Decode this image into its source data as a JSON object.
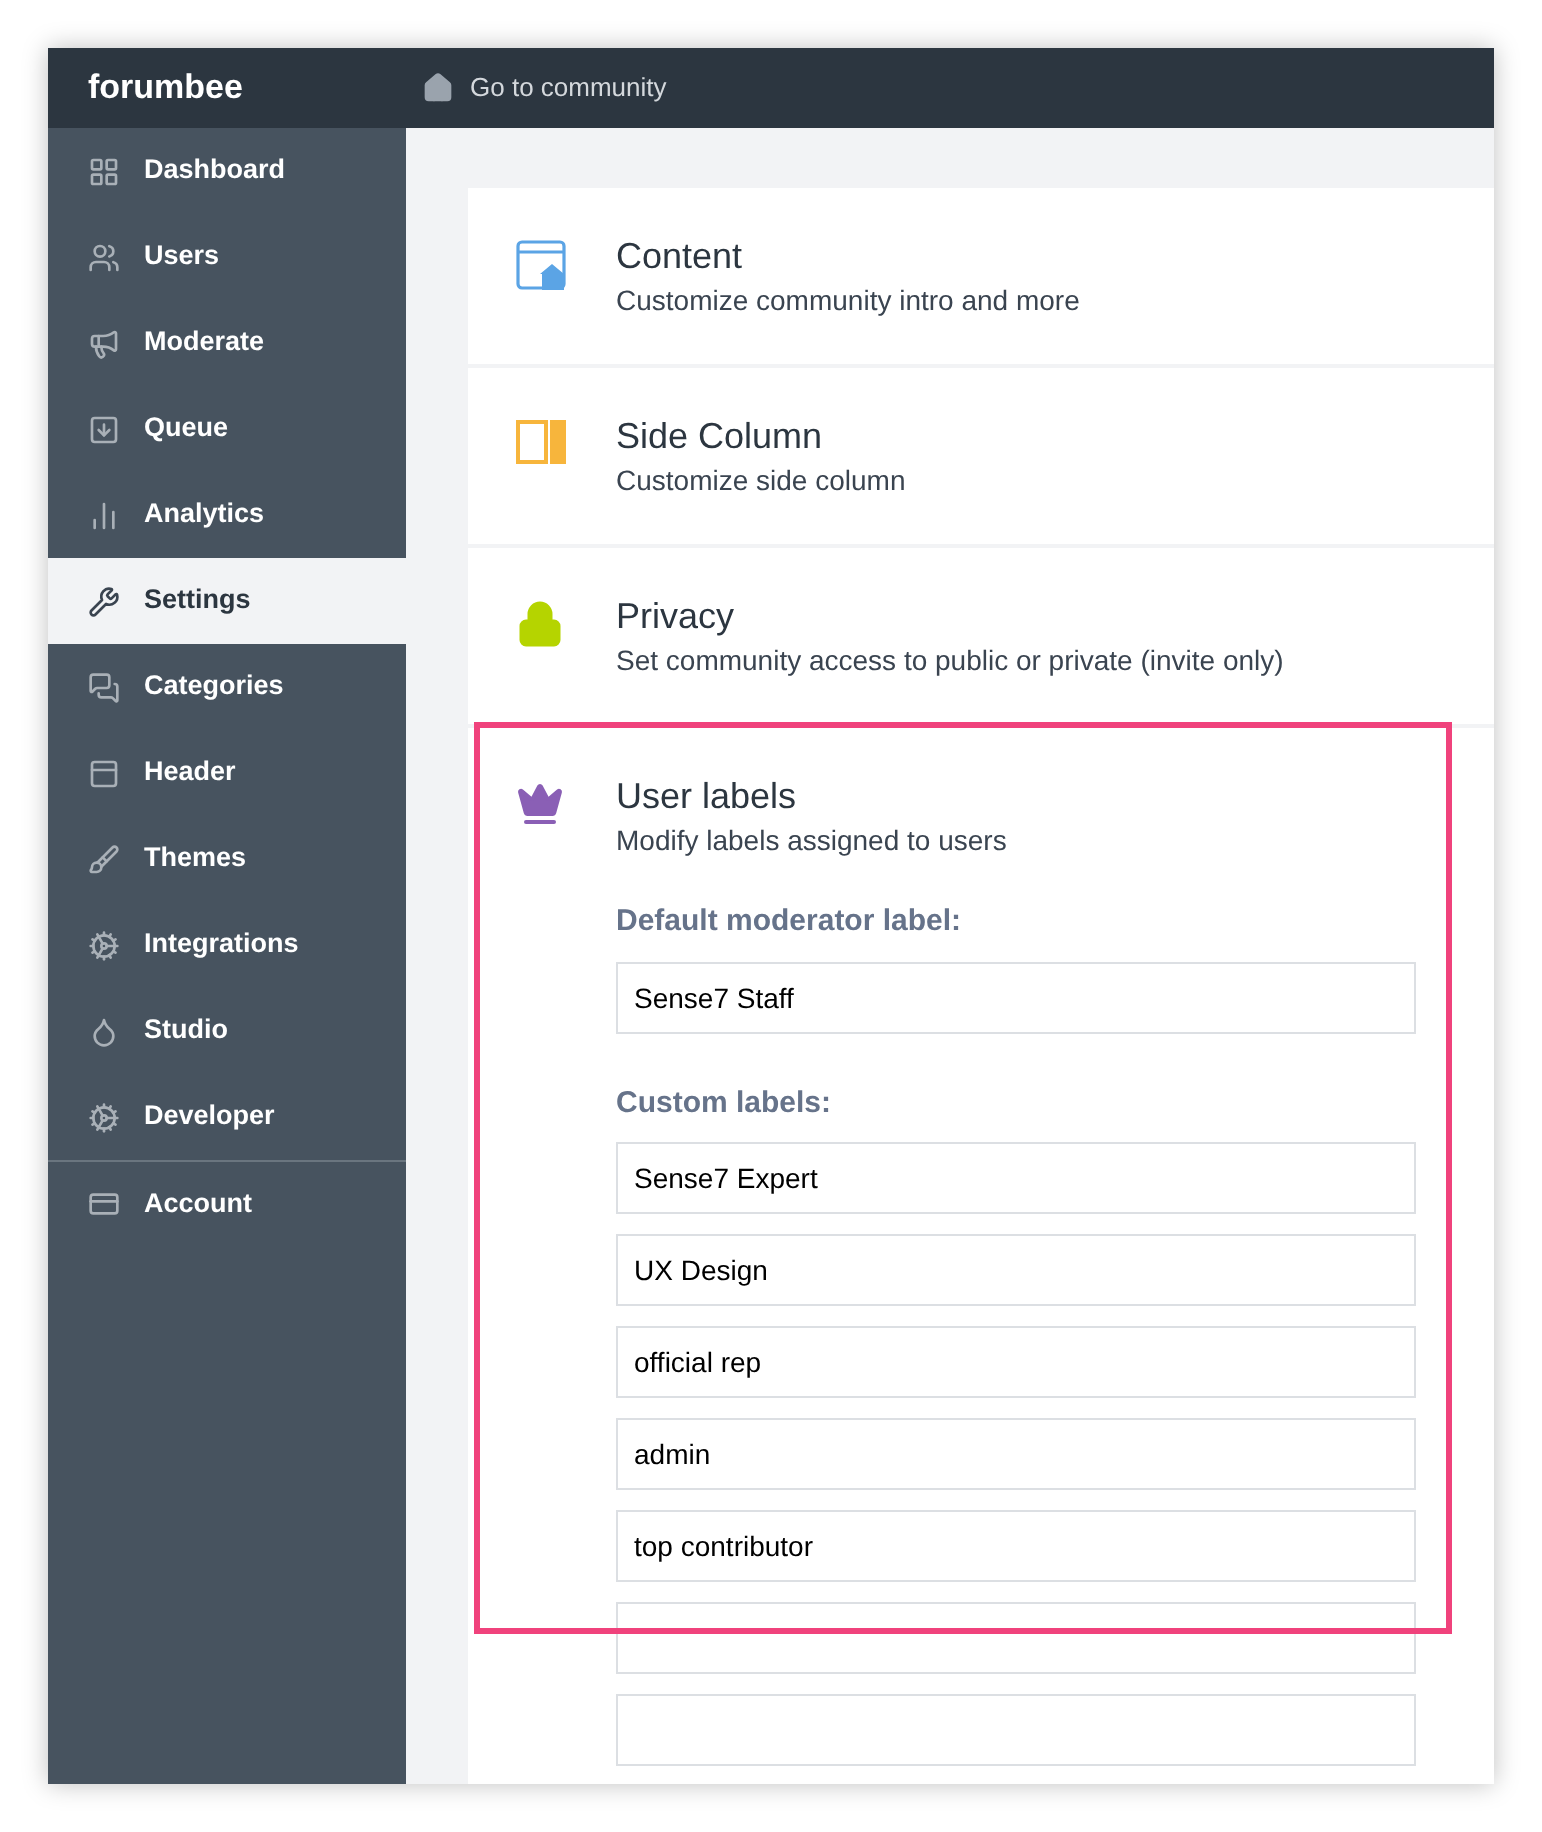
{
  "brand": "forumbee",
  "top_link": "Go to community",
  "sidebar": {
    "items": [
      {
        "label": "Dashboard",
        "selected": false
      },
      {
        "label": "Users",
        "selected": false
      },
      {
        "label": "Moderate",
        "selected": false
      },
      {
        "label": "Queue",
        "selected": false
      },
      {
        "label": "Analytics",
        "selected": false
      },
      {
        "label": "Settings",
        "selected": true
      },
      {
        "label": "Categories",
        "selected": false
      },
      {
        "label": "Header",
        "selected": false
      },
      {
        "label": "Themes",
        "selected": false
      },
      {
        "label": "Integrations",
        "selected": false
      },
      {
        "label": "Studio",
        "selected": false
      },
      {
        "label": "Developer",
        "selected": false
      },
      {
        "label": "Account",
        "selected": false
      }
    ]
  },
  "sections": [
    {
      "title": "Content",
      "subtitle": "Customize community intro and more"
    },
    {
      "title": "Side Column",
      "subtitle": "Customize side column"
    },
    {
      "title": "Privacy",
      "subtitle": "Set community access to public or private (invite only)"
    },
    {
      "title": "User labels",
      "subtitle": "Modify labels assigned to users",
      "highlighted": true,
      "default_label": {
        "label": "Default moderator label:",
        "value": "Sense7 Staff"
      },
      "custom_labels": {
        "label": "Custom labels:",
        "fields": [
          {
            "kind": "filled",
            "value": "Sense7 Expert"
          },
          {
            "kind": "filled",
            "value": "UX Design"
          },
          {
            "kind": "filled",
            "value": "official rep"
          },
          {
            "kind": "filled",
            "value": "admin"
          },
          {
            "kind": "filled",
            "value": "top contributor"
          },
          {
            "kind": "empty"
          },
          {
            "kind": "empty"
          }
        ]
      }
    }
  ]
}
